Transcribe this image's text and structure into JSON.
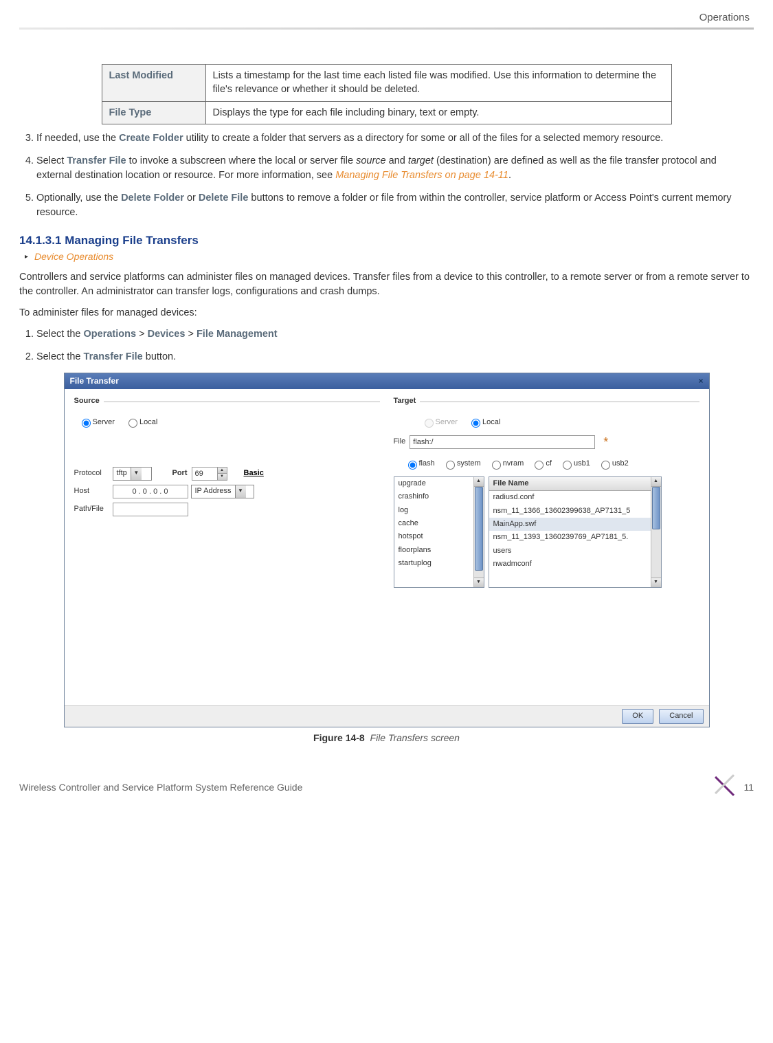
{
  "header": {
    "section": "Operations"
  },
  "defs_table": {
    "rows": [
      {
        "label": "Last Modified",
        "desc": "Lists a timestamp for the last time each listed file was modified. Use this information to determine the file's relevance or whether it should be deleted."
      },
      {
        "label": "File Type",
        "desc": "Displays the type for each file including binary, text or empty."
      }
    ]
  },
  "step3": {
    "num": "3",
    "pre": "If needed, use the ",
    "bold": "Create Folder",
    "post": " utility to create a folder that servers as a directory for some or all of the files for a selected memory resource."
  },
  "step4": {
    "num": "4",
    "pre": "Select ",
    "bold": "Transfer File",
    "mid": " to invoke a subscreen where the local or server file ",
    "i1": "source",
    "mid2": " and ",
    "i2": "target",
    "post": " (destination) are defined as well as the file transfer protocol and external destination location or resource. For more information, see ",
    "link": "Managing File Transfers on page 14-11",
    "dot": "."
  },
  "step5": {
    "num": "5",
    "pre": "Optionally, use the ",
    "b1": "Delete Folder",
    "mid": " or ",
    "b2": "Delete File",
    "post": " buttons to remove a folder or file from within the controller, service platform or Access Point's current memory resource."
  },
  "subsection": {
    "number": "14.1.3.1",
    "title": "Managing File Transfers",
    "breadcrumb": "Device Operations"
  },
  "para1": "Controllers and service platforms can administer files on managed devices. Transfer files from a device to this controller, to a remote server or from a remote server to the controller. An administrator can transfer logs, configurations and crash dumps.",
  "para2": "To administer files for managed devices:",
  "nstep1": {
    "pre": "Select the ",
    "b1": "Operations",
    "s1": " > ",
    "b2": "Devices",
    "s2": " > ",
    "b3": "File Management"
  },
  "nstep2": {
    "pre": "Select the ",
    "b1": "Transfer File",
    "post": " button."
  },
  "dialog": {
    "title": "File Transfer",
    "close": "×",
    "source": {
      "legend": "Source",
      "server_label": "Server",
      "local_label": "Local",
      "protocol_label": "Protocol",
      "protocol_value": "tftp",
      "port_label": "Port",
      "port_value": "69",
      "basic_link": "Basic",
      "host_label": "Host",
      "host_value": "0 . 0 . 0 . 0",
      "host_type": "IP Address",
      "path_label": "Path/File"
    },
    "target": {
      "legend": "Target",
      "server_label": "Server",
      "local_label": "Local",
      "file_label": "File",
      "file_value": "flash:/",
      "asterisk": "*",
      "radios": [
        "flash",
        "system",
        "nvram",
        "cf",
        "usb1",
        "usb2"
      ],
      "folders": [
        "upgrade",
        "crashinfo",
        "log",
        "cache",
        "hotspot",
        "floorplans",
        "startuplog"
      ],
      "files_header": "File Name",
      "files": [
        "radiusd.conf",
        "nsm_11_1366_13602399638_AP7131_5",
        "MainApp.swf",
        "nsm_11_1393_1360239769_AP7181_5.",
        "users",
        "nwadmconf"
      ]
    },
    "ok": "OK",
    "cancel": "Cancel"
  },
  "figure_caption": {
    "label": "Figure 14-8",
    "text": "File Transfers screen"
  },
  "footer": {
    "text": "Wireless Controller and Service Platform System Reference Guide",
    "page": "11"
  }
}
